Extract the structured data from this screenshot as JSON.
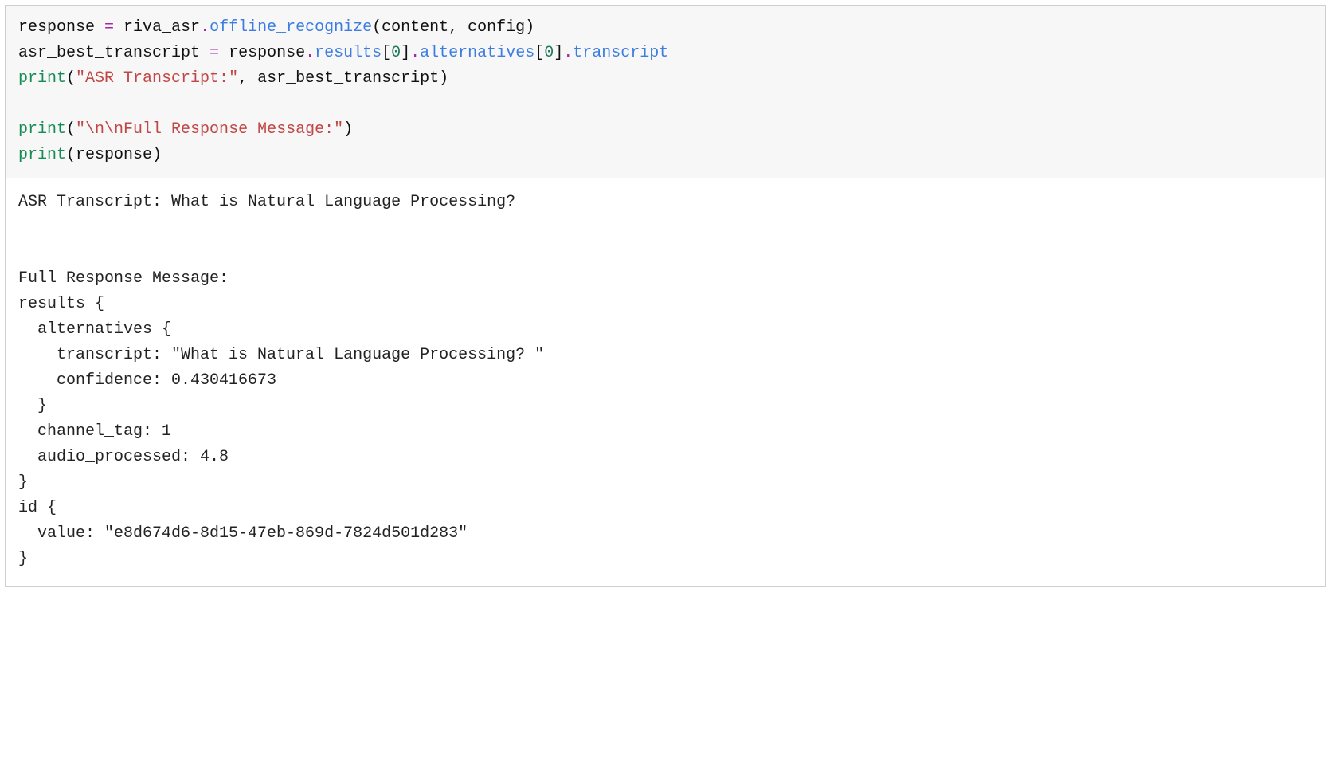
{
  "code": {
    "line1": {
      "a": "response ",
      "op1": "= ",
      "b": "riva_asr",
      "dot1": ".",
      "attr1": "offline_recognize",
      "paren1": "(",
      "c": "content, config",
      "paren2": ")"
    },
    "line2": {
      "a": "asr_best_transcript ",
      "op1": "= ",
      "b": "response",
      "dot1": ".",
      "attr1": "results",
      "br1": "[",
      "n1": "0",
      "br2": "]",
      "dot2": ".",
      "attr2": "alternatives",
      "br3": "[",
      "n2": "0",
      "br4": "]",
      "dot3": ".",
      "attr3": "transcript"
    },
    "line3": {
      "fn": "print",
      "paren1": "(",
      "str": "\"ASR Transcript:\"",
      "sep": ", asr_best_transcript",
      "paren2": ")"
    },
    "line4_blank": "",
    "line5": {
      "fn": "print",
      "paren1": "(",
      "str": "\"\\n\\nFull Response Message:\"",
      "paren2": ")"
    },
    "line6": {
      "fn": "print",
      "paren1": "(",
      "arg": "response",
      "paren2": ")"
    }
  },
  "output": {
    "l01": "ASR Transcript: What is Natural Language Processing?",
    "l02": "",
    "l03": "",
    "l04": "Full Response Message:",
    "l05": "results {",
    "l06": "  alternatives {",
    "l07": "    transcript: \"What is Natural Language Processing? \"",
    "l08": "    confidence: 0.430416673",
    "l09": "  }",
    "l10": "  channel_tag: 1",
    "l11": "  audio_processed: 4.8",
    "l12": "}",
    "l13": "id {",
    "l14": "  value: \"e8d674d6-8d15-47eb-869d-7824d501d283\"",
    "l15": "}"
  }
}
